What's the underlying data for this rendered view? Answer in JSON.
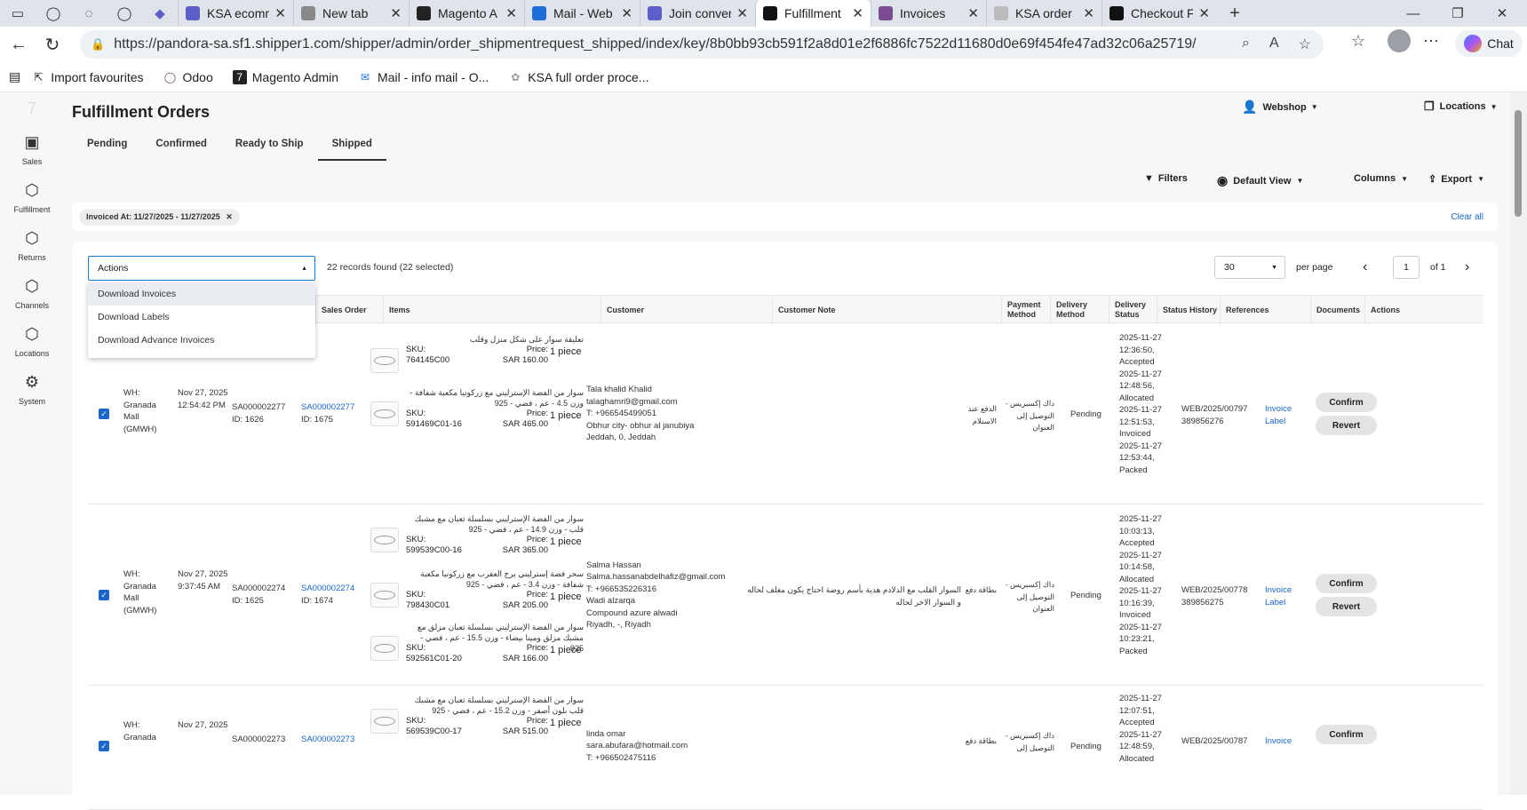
{
  "browser": {
    "tabs": [
      {
        "label": "KSA ecomm",
        "color": "#5b5fc7"
      },
      {
        "label": "New tab",
        "color": "#888888"
      },
      {
        "label": "Magento A",
        "color": "#222222"
      },
      {
        "label": "Mail - Web",
        "color": "#1e6fd9"
      },
      {
        "label": "Join conver",
        "color": "#5b5fc7"
      },
      {
        "label": "Fulfillment",
        "color": "#111111"
      },
      {
        "label": "Invoices",
        "color": "#7b4b94"
      },
      {
        "label": "KSA order",
        "color": "#bbbbbb"
      },
      {
        "label": "Checkout F",
        "color": "#111111"
      }
    ],
    "url": "https://pandora-sa.sf1.shipper1.com/shipper/admin/order_shipmentrequest_shipped/index/key/8b0bb93cb591f2a8d01e2f6886fc7522d11680d0e69f454fe47ad32c06a25719/",
    "chat_label": "Chat",
    "bookmarks": [
      "Import favourites",
      "Odoo",
      "Magento Admin",
      "Mail - info mail - O...",
      "KSA full order proce..."
    ]
  },
  "sidebar": [
    {
      "label": "Sales",
      "icon": "sales-icon"
    },
    {
      "label": "Fulfillment",
      "icon": "fulfillment-icon"
    },
    {
      "label": "Returns",
      "icon": "returns-icon"
    },
    {
      "label": "Channels",
      "icon": "channels-icon"
    },
    {
      "label": "Locations",
      "icon": "locations-icon"
    },
    {
      "label": "System",
      "icon": "gear-icon"
    }
  ],
  "page": {
    "title": "Fulfillment Orders",
    "tabs": [
      "Pending",
      "Confirmed",
      "Ready to Ship",
      "Shipped"
    ],
    "active_tab": "Shipped",
    "webshop": "Webshop",
    "locations": "Locations",
    "filters": "Filters",
    "default_view": "Default View",
    "columns": "Columns",
    "export": "Export",
    "chip": "Invoiced At: 11/27/2025 - 11/27/2025",
    "clear_all": "Clear all"
  },
  "table_toolbar": {
    "actions_label": "Actions",
    "records": "22 records found (22 selected)",
    "actions_menu": [
      "Download Invoices",
      "Download Labels",
      "Download Advance Invoices"
    ],
    "per_page_value": "30",
    "per_page_label": "per page",
    "page": "1",
    "of": "of 1"
  },
  "columns": [
    "Sales Order",
    "Items",
    "Customer",
    "Customer Note",
    "Payment Method",
    "Delivery Method",
    "Delivery Status",
    "Status History",
    "References",
    "Documents",
    "Actions"
  ],
  "rows": [
    {
      "warehouse": "WH: Granada Mall (GMWH)",
      "date": "Nov 27, 2025 12:54:42 PM",
      "shipment": "SA000002277",
      "shipment_id": "ID: 1626",
      "order": "SA000002277",
      "order_id": "ID: 1675",
      "items": [
        {
          "name": "تعليقة سوار على شكل منزل وقلب",
          "sku_label": "SKU:",
          "sku": "764145C00",
          "price_label": "Price:",
          "price": "SAR 160.00",
          "qty": "1 piece"
        },
        {
          "name": "سوار من الفضة الإسترليني مع زركونيا مكعبة شفافة - وزن 4.5 - عم ، فضي - 925",
          "sku_label": "SKU:",
          "sku": "591469C01-16",
          "price_label": "Price:",
          "price": "SAR 465.00",
          "qty": "1 piece"
        }
      ],
      "customer": [
        "Tala khalid Khalid",
        "talaghamri9@gmail.com",
        "T: +966545499051",
        "Obhur city- obhur al janubiya",
        "Jeddah, 0, Jeddah"
      ],
      "note": "",
      "payment": "الدفع عند الاستلام",
      "delivery": "داك إكسبريس - التوصيل إلى العنوان",
      "status": "Pending",
      "history": [
        "2025-11-27",
        "12:36:50,",
        "Accepted",
        "2025-11-27",
        "12:48:56,",
        "Allocated",
        "2025-11-27",
        "12:51:53,",
        "Invoiced",
        "2025-11-27",
        "12:53:44,",
        "Packed"
      ],
      "references": [
        "WEB/2025/00797",
        "389856276"
      ],
      "docs": [
        "Invoice",
        "Label"
      ],
      "actions": [
        "Confirm",
        "Revert"
      ]
    },
    {
      "warehouse": "WH: Granada Mall (GMWH)",
      "date": "Nov 27, 2025 9:37:45 AM",
      "shipment": "SA000002274",
      "shipment_id": "ID: 1625",
      "order": "SA000002274",
      "order_id": "ID: 1674",
      "items": [
        {
          "name": "سوار من الفضة الإسترليني بسلسلة ثعبان مع مشبك قلب - وزن 14.9 - عم ، فضي - 925",
          "sku_label": "SKU:",
          "sku": "599539C00-16",
          "price_label": "Price:",
          "price": "SAR 365.00",
          "qty": "1 piece"
        },
        {
          "name": "سحر فضة إسترليني برج العقرب مع زركونيا مكعبة شفافة - وزن 3.4 - عم ، فضي - 925",
          "sku_label": "SKU:",
          "sku": "798430C01",
          "price_label": "Price:",
          "price": "SAR 205.00",
          "qty": "1 piece"
        },
        {
          "name": "سوار من الفضة الإسترليني بسلسلة ثعبان مزلق مع مشبك مزلق ومينا بيضاء - وزن 15.5 - عم ، فضي - 925",
          "sku_label": "SKU:",
          "sku": "592561C01-20",
          "price_label": "Price:",
          "price": "SAR 166.00",
          "qty": "1 piece"
        }
      ],
      "customer": [
        "Salma Hassan",
        "Salma.hassanabdelhafiz@gmail.com",
        "T: +966535226316",
        "Wadi alzarqa",
        "Compound azure alwadi",
        "Riyadh, -, Riyadh"
      ],
      "note": "السوار القلب مع الدلادم هدية بأسم روضة احتاج يكون مغلف لحاله و السوار الاخر لحاله",
      "payment": "بطاقة دفع",
      "delivery": "داك إكسبريس - التوصيل إلى العنوان",
      "status": "Pending",
      "history": [
        "2025-11-27",
        "10:03:13,",
        "Accepted",
        "2025-11-27",
        "10:14:58,",
        "Allocated",
        "2025-11-27",
        "10:16:39,",
        "Invoiced",
        "2025-11-27",
        "10:23:21,",
        "Packed"
      ],
      "references": [
        "WEB/2025/00778",
        "389856275"
      ],
      "docs": [
        "Invoice",
        "Label"
      ],
      "actions": [
        "Confirm",
        "Revert"
      ]
    },
    {
      "warehouse": "WH: Granada",
      "date": "Nov 27, 2025",
      "shipment": "SA000002273",
      "order": "SA000002273",
      "items": [
        {
          "name": "سوار من الفضة الإسترليني بسلسلة ثعبان مع مشبك قلب بلون أصفر - وزن 15.2 - عم ، فضي - 925",
          "sku_label": "SKU:",
          "sku": "569539C00-17",
          "price_label": "Price:",
          "price": "SAR 515.00",
          "qty": "1 piece"
        }
      ],
      "customer": [
        "linda omar",
        "sara.abufara@hotmail.com",
        "T: +966502475116"
      ],
      "payment": "بطاقة دفع",
      "delivery": "داك إكسبريس - التوصيل إلى",
      "status": "Pending",
      "history": [
        "2025-11-27",
        "12:07:51,",
        "Accepted",
        "2025-11-27",
        "12:48:59,",
        "Allocated"
      ],
      "references": [
        "WEB/2025/00787"
      ],
      "docs": [
        "Invoice"
      ],
      "actions": [
        "Confirm"
      ]
    }
  ]
}
